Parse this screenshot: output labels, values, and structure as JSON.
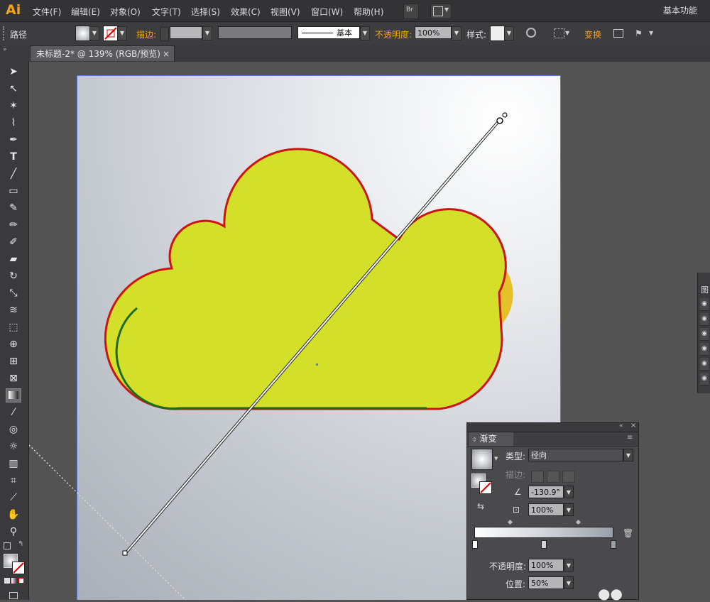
{
  "app": {
    "logo": "Ai",
    "bridge_badge": "Br",
    "workspace": "基本功能"
  },
  "menu": [
    "文件(F)",
    "编辑(E)",
    "对象(O)",
    "文字(T)",
    "选择(S)",
    "效果(C)",
    "视图(V)",
    "窗口(W)",
    "帮助(H)"
  ],
  "control_bar": {
    "object_type": "路径",
    "stroke_label": "描边:",
    "stroke_style": "基本",
    "opacity_label": "不透明度:",
    "opacity_value": "100%",
    "style_label": "样式:",
    "transform_label": "变换"
  },
  "document_tab": {
    "title": "未标题-2* @ 139% (RGB/预览)",
    "close": "×"
  },
  "gradient_panel": {
    "tab_label": "渐变",
    "type_label": "类型:",
    "type_value": "径向",
    "stroke_label": "描边:",
    "angle_value": "-130.9°",
    "aspect_value": "100%",
    "opacity_label": "不透明度:",
    "opacity_value": "100%",
    "location_label": "位置:",
    "location_value": "50%"
  },
  "layers_strip": {
    "title": "图"
  },
  "colors": {
    "cloud_fill": "#d4df2a",
    "cloud_shadow": "#e6c22a",
    "stroke_top": "#cc1414",
    "stroke_bottom": "#1b6b1b",
    "accent": "#f0a51c"
  }
}
